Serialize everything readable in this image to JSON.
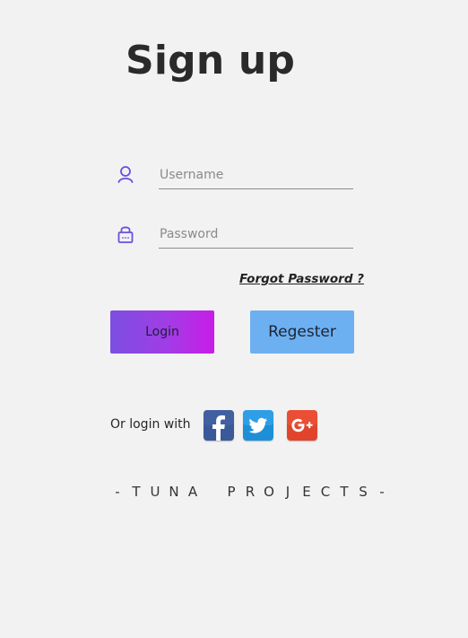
{
  "page": {
    "title": "Sign up"
  },
  "form": {
    "username": {
      "icon": "user-icon",
      "placeholder": "Username",
      "value": ""
    },
    "password": {
      "icon": "lock-icon",
      "placeholder": "Password",
      "value": ""
    },
    "forgot_password_label": "Forgot Password ?",
    "login_label": "Login",
    "register_label": "Regester"
  },
  "social": {
    "label": "Or login with",
    "providers": [
      {
        "name": "facebook",
        "icon": "facebook-icon",
        "color": "#3b5998"
      },
      {
        "name": "twitter",
        "icon": "twitter-icon",
        "color": "#1da1f2"
      },
      {
        "name": "google-plus",
        "icon": "google-plus-icon",
        "color": "#e5402f"
      }
    ]
  },
  "footer": {
    "text": "-TUNA PROJECTS-"
  },
  "colors": {
    "background": "#f2f2f2",
    "accent_icon": "#6c4ee0",
    "login_gradient_start": "#7b4fe0",
    "login_gradient_end": "#c81de6",
    "register_button": "#6db0f2"
  }
}
